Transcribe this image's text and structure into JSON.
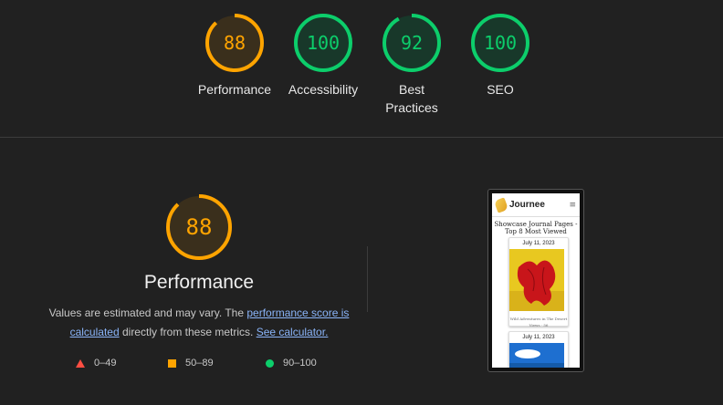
{
  "summary": {
    "gauges": [
      {
        "score": "88",
        "label": "Performance",
        "value": 0.88,
        "color": "#ffa400",
        "bg": "#3a2f1c"
      },
      {
        "score": "100",
        "label": "Accessibility",
        "value": 1.0,
        "color": "#0cce6b",
        "bg": "#18382a"
      },
      {
        "score": "92",
        "label": "Best Practices",
        "value": 0.92,
        "color": "#0cce6b",
        "bg": "#18382a"
      },
      {
        "score": "100",
        "label": "SEO",
        "value": 1.0,
        "color": "#0cce6b",
        "bg": "#18382a"
      }
    ]
  },
  "performance": {
    "score": "88",
    "value": 0.88,
    "color": "#ffa400",
    "title": "Performance",
    "desc_pre": "Values are estimated and may vary. The ",
    "link_score": "performance score is calculated",
    "desc_mid": " directly from these metrics. ",
    "link_calc": "See calculator."
  },
  "legend": {
    "fail": "0–49",
    "average": "50–89",
    "pass": "90–100",
    "colors": {
      "fail": "#ff4e42",
      "average": "#ffa400",
      "pass": "#0cce6b"
    }
  },
  "screenshot": {
    "brand": "Journee",
    "menu_icon": "hamburger-menu-icon",
    "title": "Showcase Journal Pages - Top 8 Most Viewed",
    "cards": [
      {
        "date": "July 11, 2023",
        "caption": "Wild Adventures in The Desert",
        "meta": "Views · 56"
      },
      {
        "date": "July 11, 2023"
      }
    ]
  }
}
